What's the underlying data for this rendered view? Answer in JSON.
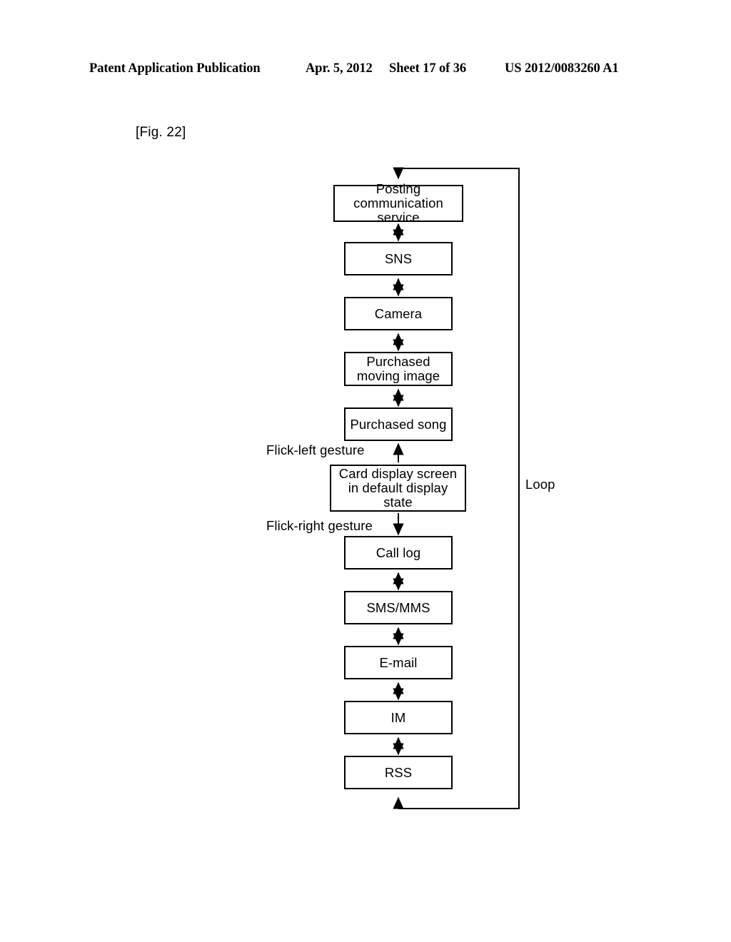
{
  "header": {
    "publication": "Patent Application Publication",
    "date": "Apr. 5, 2012",
    "sheet": "Sheet 17 of 36",
    "number": "US 2012/0083260 A1"
  },
  "figure": {
    "label": "[Fig. 22]"
  },
  "diagram": {
    "type": "flowchart",
    "orientation": "vertical",
    "nodes": [
      {
        "id": "posting",
        "label": "Posting communication service"
      },
      {
        "id": "sns",
        "label": "SNS"
      },
      {
        "id": "camera",
        "label": "Camera"
      },
      {
        "id": "moving-image",
        "label": "Purchased moving image"
      },
      {
        "id": "song",
        "label": "Purchased song"
      },
      {
        "id": "card-default",
        "label": "Card display screen in default display state"
      },
      {
        "id": "call-log",
        "label": "Call log"
      },
      {
        "id": "sms-mms",
        "label": "SMS/MMS"
      },
      {
        "id": "email",
        "label": "E-mail"
      },
      {
        "id": "im",
        "label": "IM"
      },
      {
        "id": "rss",
        "label": "RSS"
      }
    ],
    "annotations": {
      "flick_left": "Flick-left gesture",
      "flick_right": "Flick-right gesture",
      "loop": "Loop"
    },
    "colors": {
      "stroke": "#000000",
      "fill": "#ffffff",
      "text": "#000000"
    }
  }
}
